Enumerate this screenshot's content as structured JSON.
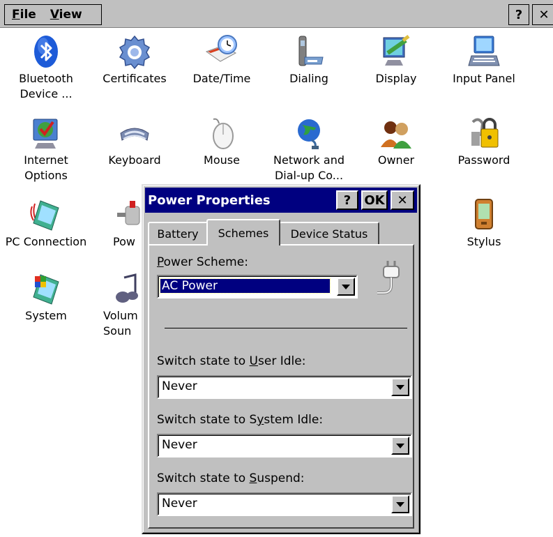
{
  "menubar": {
    "file": {
      "prefix": "F",
      "rest": "ile"
    },
    "view": {
      "prefix": "V",
      "rest": "iew"
    },
    "help_btn": "?",
    "close_btn": "✕"
  },
  "control_panel": {
    "items": [
      {
        "label": "Bluetooth Device ...",
        "icon": "bluetooth-icon"
      },
      {
        "label": "Certificates",
        "icon": "certificates-icon"
      },
      {
        "label": "Date/Time",
        "icon": "date-time-icon"
      },
      {
        "label": "Dialing",
        "icon": "dialing-icon"
      },
      {
        "label": "Display",
        "icon": "display-icon"
      },
      {
        "label": "Input Panel",
        "icon": "input-panel-icon"
      },
      {
        "label": "Internet Options",
        "icon": "internet-options-icon"
      },
      {
        "label": "Keyboard",
        "icon": "keyboard-icon"
      },
      {
        "label": "Mouse",
        "icon": "mouse-icon"
      },
      {
        "label": "Network and Dial-up Co...",
        "icon": "network-icon"
      },
      {
        "label": "Owner",
        "icon": "owner-icon"
      },
      {
        "label": "Password",
        "icon": "password-icon"
      },
      {
        "label": "PC Connection",
        "icon": "pc-connection-icon"
      },
      {
        "label": "Pow",
        "icon": "power-icon"
      },
      {
        "label": "Stylus",
        "icon": "stylus-icon"
      },
      {
        "label": "System",
        "icon": "system-icon"
      },
      {
        "label": "Volum Soun",
        "icon": "volume-sounds-icon"
      }
    ]
  },
  "dialog": {
    "title": "Power Properties",
    "help_btn": "?",
    "ok_btn": "OK",
    "close_btn": "✕",
    "tabs": [
      "Battery",
      "Schemes",
      "Device Status"
    ],
    "active_tab": "Schemes",
    "power_scheme": {
      "label_prefix": "",
      "label_ul": "P",
      "label_rest": "ower Scheme:",
      "value": "AC Power"
    },
    "user_idle": {
      "label_prefix": "Switch state to ",
      "label_ul": "U",
      "label_rest": "ser Idle:",
      "value": "Never"
    },
    "system_idle": {
      "label_prefix": "Switch state to S",
      "label_ul": "y",
      "label_rest": "stem Idle:",
      "value": "Never"
    },
    "suspend": {
      "label_prefix": "Switch state to ",
      "label_ul": "S",
      "label_rest": "uspend:",
      "value": "Never"
    }
  },
  "colors": {
    "title_bar": "#000080",
    "dialog_bg": "#c0c0c0",
    "desktop_bg": "#ffffff"
  }
}
